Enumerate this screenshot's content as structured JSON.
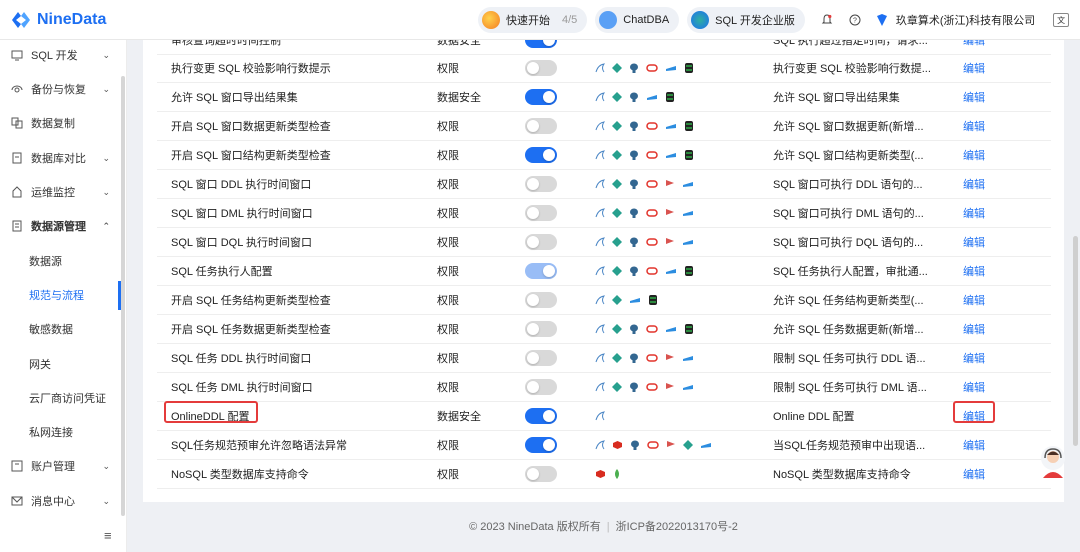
{
  "header": {
    "brand": "NineData",
    "quickstart": {
      "label": "快速开始",
      "progress": "4/5"
    },
    "chatdba": "ChatDBA",
    "edition": "SQL 开发企业版",
    "org": "玖章算术(浙江)科技有限公司",
    "icons": [
      "bell-icon",
      "help-icon",
      "org-logo-icon",
      "language-icon"
    ]
  },
  "sidebar": {
    "items": [
      {
        "label": "SQL 开发",
        "icon": "sql-icon",
        "chevron": "⌄"
      },
      {
        "label": "备份与恢复",
        "icon": "backup-icon",
        "chevron": "⌄"
      },
      {
        "label": "数据复制",
        "icon": "copy-icon"
      },
      {
        "label": "数据库对比",
        "icon": "compare-icon",
        "chevron": "⌄"
      },
      {
        "label": "运维监控",
        "icon": "monitor-icon",
        "chevron": "⌄"
      },
      {
        "label": "数据源管理",
        "icon": "datasource-icon",
        "chevron": "⌃"
      },
      {
        "label": "账户管理",
        "icon": "account-icon",
        "chevron": "⌄"
      },
      {
        "label": "消息中心",
        "icon": "message-icon",
        "chevron": "⌄"
      }
    ],
    "subitems": [
      "数据源",
      "规范与流程",
      "敏感数据",
      "网关",
      "云厂商访问凭证",
      "私网连接"
    ],
    "active_sub": "规范与流程",
    "collapse_glyph": "≡"
  },
  "table": {
    "action_label": "编辑",
    "partial_top": {
      "name": "审核查询超时时间控制",
      "type": "数据安全",
      "desc": "SQL 执行超过指定时间，请求..."
    },
    "rows": [
      {
        "name": "执行变更 SQL 校验影响行数提示",
        "type": "权限",
        "toggle": "off",
        "dbs": "mysql,ds,pg,oracle,sqlsrv,db",
        "desc": "执行变更 SQL 校验影响行数提..."
      },
      {
        "name": "允许 SQL 窗口导出结果集",
        "type": "数据安全",
        "toggle": "on",
        "dbs": "mysql,ds,pg,sqlsrv,db",
        "desc": "允许 SQL 窗口导出结果集"
      },
      {
        "name": "开启 SQL 窗口数据更新类型检查",
        "type": "权限",
        "toggle": "off",
        "dbs": "mysql,ds,pg,oracle,sqlsrv,db",
        "desc": "允许 SQL 窗口数据更新(新增..."
      },
      {
        "name": "开启 SQL 窗口结构更新类型检查",
        "type": "权限",
        "toggle": "on",
        "dbs": "mysql,ds,pg,oracle,sqlsrv,db",
        "desc": "允许 SQL 窗口结构更新类型(..."
      },
      {
        "name": "SQL 窗口 DDL 执行时间窗口",
        "type": "权限",
        "toggle": "off",
        "dbs": "mysql,ds,pg,oracle,flag,sqlsrv",
        "desc": "SQL 窗口可执行 DDL 语句的..."
      },
      {
        "name": "SQL 窗口 DML 执行时间窗口",
        "type": "权限",
        "toggle": "off",
        "dbs": "mysql,ds,pg,oracle,flag,sqlsrv",
        "desc": "SQL 窗口可执行 DML 语句的..."
      },
      {
        "name": "SQL 窗口 DQL 执行时间窗口",
        "type": "权限",
        "toggle": "off",
        "dbs": "mysql,ds,pg,oracle,flag,sqlsrv",
        "desc": "SQL 窗口可执行 DQL 语句的..."
      },
      {
        "name": "SQL 任务执行人配置",
        "type": "权限",
        "toggle": "dis",
        "dbs": "mysql,ds,pg,oracle,sqlsrv,db",
        "desc": "SQL 任务执行人配置，审批通..."
      },
      {
        "name": "开启 SQL 任务结构更新类型检查",
        "type": "权限",
        "toggle": "off",
        "dbs": "mysql,ds,sqlsrv,db",
        "desc": "允许 SQL 任务结构更新类型(..."
      },
      {
        "name": "开启 SQL 任务数据更新类型检查",
        "type": "权限",
        "toggle": "off",
        "dbs": "mysql,ds,pg,oracle,sqlsrv,db",
        "desc": "允许 SQL 任务数据更新(新增..."
      },
      {
        "name": "SQL 任务 DDL 执行时间窗口",
        "type": "权限",
        "toggle": "off",
        "dbs": "mysql,ds,pg,oracle,flag,sqlsrv",
        "desc": "限制 SQL 任务可执行 DDL 语..."
      },
      {
        "name": "SQL 任务 DML 执行时间窗口",
        "type": "权限",
        "toggle": "off",
        "dbs": "mysql,ds,pg,oracle,flag,sqlsrv",
        "desc": "限制 SQL 任务可执行 DML 语..."
      },
      {
        "name": "OnlineDDL 配置",
        "type": "数据安全",
        "toggle": "on",
        "dbs": "mysql",
        "desc": "Online DDL 配置",
        "highlight": true
      },
      {
        "name": "SQL任务规范预审允许忽略语法异常",
        "type": "权限",
        "toggle": "on",
        "dbs": "mysql,redis,pg,oracle,flag,ds,sqlsrv",
        "desc": "当SQL任务规范预审中出现语..."
      },
      {
        "name": "NoSQL 类型数据库支持命令",
        "type": "权限",
        "toggle": "off",
        "dbs": "redis,mongo",
        "desc": "NoSQL 类型数据库支持命令"
      }
    ]
  },
  "footer": {
    "copyright": "© 2023 NineData 版权所有",
    "icp": "浙ICP备2022013170号-2"
  },
  "colors": {
    "brand": "#1d6ff2",
    "highlight": "#e43b3b",
    "db": {
      "mysql": "#4a86c5",
      "ds": "#27a08e",
      "pg": "#336791",
      "oracle": "#e2342c",
      "sqlsrv": "#2c8de0",
      "db": "#2b8a3e",
      "flag": "#d9534f",
      "redis": "#d82c20",
      "mongo": "#4caf50"
    }
  }
}
